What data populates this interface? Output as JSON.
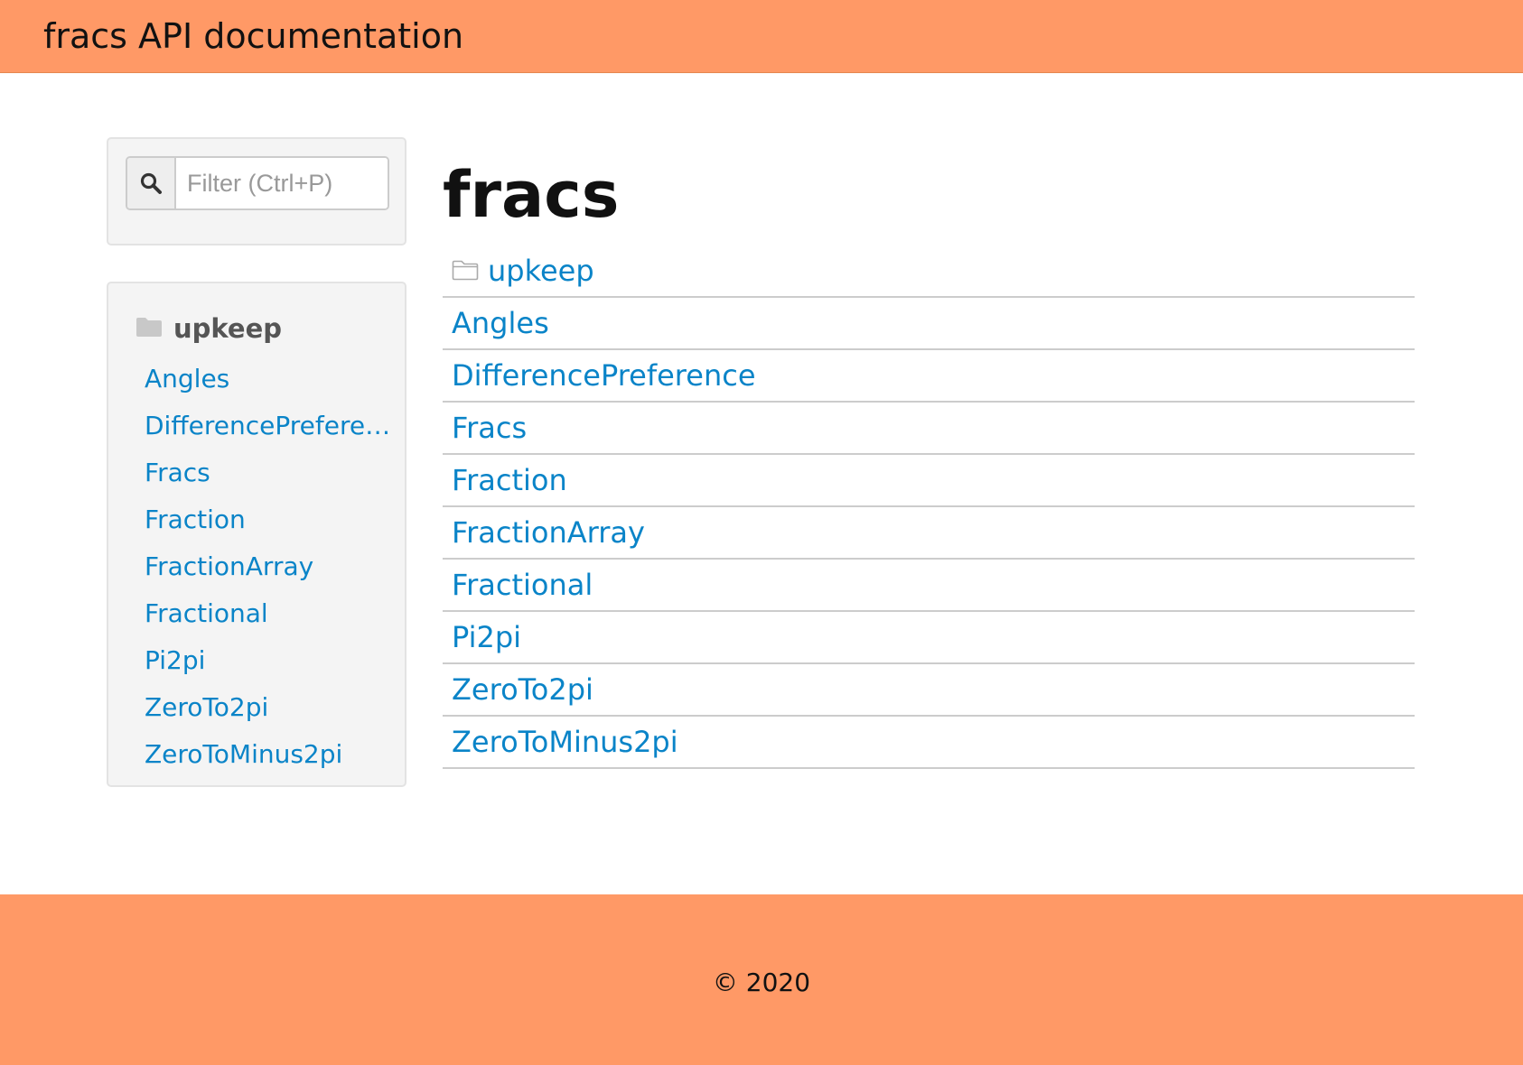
{
  "header": {
    "title": "fracs API documentation"
  },
  "filter": {
    "icon": "search-icon",
    "placeholder": "Filter (Ctrl+P)",
    "value": ""
  },
  "sidebar": {
    "folder": {
      "icon": "folder-icon",
      "label": "upkeep"
    },
    "items": [
      {
        "label": "Angles"
      },
      {
        "label": "DifferencePreference"
      },
      {
        "label": "Fracs"
      },
      {
        "label": "Fraction"
      },
      {
        "label": "FractionArray"
      },
      {
        "label": "Fractional"
      },
      {
        "label": "Pi2pi"
      },
      {
        "label": "ZeroTo2pi"
      },
      {
        "label": "ZeroToMinus2pi"
      }
    ]
  },
  "main": {
    "title": "fracs",
    "folder": {
      "icon": "folder-outline-icon",
      "label": "upkeep"
    },
    "items": [
      {
        "label": "Angles"
      },
      {
        "label": "DifferencePreference"
      },
      {
        "label": "Fracs"
      },
      {
        "label": "Fraction"
      },
      {
        "label": "FractionArray"
      },
      {
        "label": "Fractional"
      },
      {
        "label": "Pi2pi"
      },
      {
        "label": "ZeroTo2pi"
      },
      {
        "label": "ZeroToMinus2pi"
      }
    ]
  },
  "footer": {
    "text": "© 2020"
  },
  "colors": {
    "header_bg": "#ff9966",
    "footer_bg": "#ff9966",
    "link": "#0a84c8",
    "panel_bg": "#f4f4f4"
  }
}
